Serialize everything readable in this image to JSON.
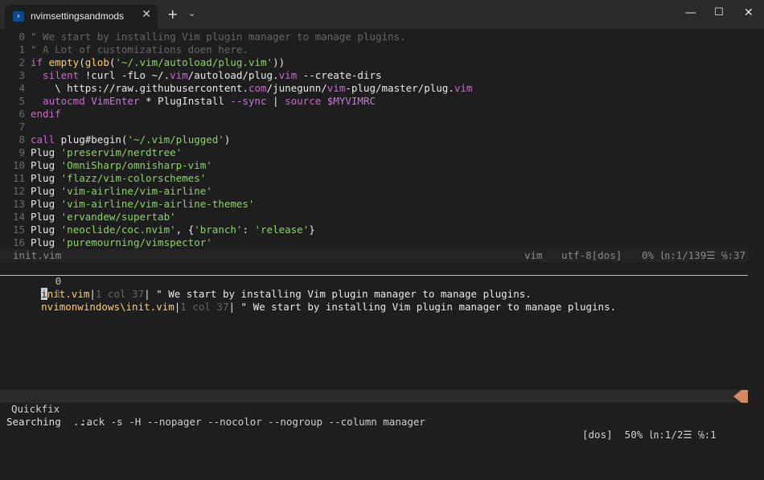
{
  "window": {
    "tab_title": "nvimsettingsandmods",
    "tab_icon": "powershell-icon",
    "new_tab": "+",
    "dropdown": "⌄",
    "close_tab": "✕",
    "minimize": "—",
    "maximize": "☐",
    "close": "✕"
  },
  "editor": {
    "lines": [
      {
        "n": "0",
        "segments": [
          {
            "t": "\" We start by installing Vim plugin manager to manage plugins.",
            "c": "c-comment"
          }
        ]
      },
      {
        "n": "1",
        "segments": [
          {
            "t": "\" A Lot of customizations doen here.",
            "c": "c-comment"
          }
        ]
      },
      {
        "n": "2",
        "segments": [
          {
            "t": "if ",
            "c": "c-kw"
          },
          {
            "t": "empty",
            "c": "c-fn"
          },
          {
            "t": "(",
            "c": "c-plain"
          },
          {
            "t": "glob",
            "c": "c-fn"
          },
          {
            "t": "(",
            "c": "c-plain"
          },
          {
            "t": "'~/.vim/autoload/plug.vim'",
            "c": "c-str"
          },
          {
            "t": "))",
            "c": "c-plain"
          }
        ]
      },
      {
        "n": "3",
        "segments": [
          {
            "t": "  silent ",
            "c": "c-kw"
          },
          {
            "t": "!curl -fLo ~/.",
            "c": "c-plain"
          },
          {
            "t": "vim",
            "c": "c-kw"
          },
          {
            "t": "/autoload/plug.",
            "c": "c-plain"
          },
          {
            "t": "vim",
            "c": "c-kw"
          },
          {
            "t": " --create-dirs",
            "c": "c-plain"
          }
        ]
      },
      {
        "n": "4",
        "segments": [
          {
            "t": "    \\ https://raw.githubusercontent.",
            "c": "c-plain"
          },
          {
            "t": "com",
            "c": "c-kw"
          },
          {
            "t": "/junegunn/",
            "c": "c-plain"
          },
          {
            "t": "vim",
            "c": "c-kw"
          },
          {
            "t": "-plug/master/plug.",
            "c": "c-plain"
          },
          {
            "t": "vim",
            "c": "c-kw"
          }
        ]
      },
      {
        "n": "5",
        "segments": [
          {
            "t": "  autocmd ",
            "c": "c-kw"
          },
          {
            "t": "VimEnter",
            "c": "c-var"
          },
          {
            "t": " * PlugInstall ",
            "c": "c-plain"
          },
          {
            "t": "--sync",
            "c": "c-var"
          },
          {
            "t": " | ",
            "c": "c-plain"
          },
          {
            "t": "source ",
            "c": "c-kw"
          },
          {
            "t": "$MYVIMRC",
            "c": "c-var"
          }
        ]
      },
      {
        "n": "6",
        "segments": [
          {
            "t": "endif",
            "c": "c-kw"
          }
        ]
      },
      {
        "n": "7",
        "segments": []
      },
      {
        "n": "8",
        "segments": [
          {
            "t": "call ",
            "c": "c-kw"
          },
          {
            "t": "plug#begin(",
            "c": "c-plain"
          },
          {
            "t": "'~/.vim/plugged'",
            "c": "c-str"
          },
          {
            "t": ")",
            "c": "c-plain"
          }
        ]
      },
      {
        "n": "9",
        "segments": [
          {
            "t": "Plug ",
            "c": "c-plain"
          },
          {
            "t": "'preservim/nerdtree'",
            "c": "c-str"
          }
        ]
      },
      {
        "n": "10",
        "segments": [
          {
            "t": "Plug ",
            "c": "c-plain"
          },
          {
            "t": "'OmniSharp/omnisharp-vim'",
            "c": "c-str"
          }
        ]
      },
      {
        "n": "11",
        "segments": [
          {
            "t": "Plug ",
            "c": "c-plain"
          },
          {
            "t": "'flazz/vim-colorschemes'",
            "c": "c-str"
          }
        ]
      },
      {
        "n": "12",
        "segments": [
          {
            "t": "Plug ",
            "c": "c-plain"
          },
          {
            "t": "'vim-airline/vim-airline'",
            "c": "c-str"
          }
        ]
      },
      {
        "n": "13",
        "segments": [
          {
            "t": "Plug ",
            "c": "c-plain"
          },
          {
            "t": "'vim-airline/vim-airline-themes'",
            "c": "c-str"
          }
        ]
      },
      {
        "n": "14",
        "segments": [
          {
            "t": "Plug ",
            "c": "c-plain"
          },
          {
            "t": "'ervandew/supertab'",
            "c": "c-str"
          }
        ]
      },
      {
        "n": "15",
        "segments": [
          {
            "t": "Plug ",
            "c": "c-plain"
          },
          {
            "t": "'neoclide/coc.nvim'",
            "c": "c-str"
          },
          {
            "t": ", {",
            "c": "c-plain"
          },
          {
            "t": "'branch'",
            "c": "c-str"
          },
          {
            "t": ": ",
            "c": "c-plain"
          },
          {
            "t": "'release'",
            "c": "c-str"
          },
          {
            "t": "}",
            "c": "c-plain"
          }
        ]
      },
      {
        "n": "16",
        "segments": [
          {
            "t": "Plug ",
            "c": "c-plain"
          },
          {
            "t": "'puremourning/vimspector'",
            "c": "c-str"
          }
        ]
      }
    ]
  },
  "statusline_top": {
    "file": "init.vim",
    "filetype": "vim",
    "encoding": "utf-8[dos]",
    "position": "0% ㏑:1/139☰ ℅:37"
  },
  "quickfix": {
    "rows": [
      {
        "n": "0",
        "file": "init.vim",
        "loc": "1 col 37",
        "text": " \" We start by installing Vim plugin manager to manage plugins."
      },
      {
        "n": "1",
        "file": "nvimonwindows\\init.vim",
        "loc": "1 col 37",
        "text": " \" We start by installing Vim plugin manager to manage plugins."
      }
    ]
  },
  "statusline_bottom": {
    "mode": "Quickfix",
    "command": ":ack -s -H --nopager --nocolor --nogroup --column manager",
    "right": "[dos]  50% ㏑:1/2☰ ℅:1"
  },
  "cmdline": {
    "text": "Searching  ..."
  },
  "colors": {
    "background": "#1e1e1e",
    "comment": "#666666",
    "keyword": "#d75fd7",
    "string": "#87d75f",
    "function": "#ffcc66",
    "accent": "#d7875f"
  }
}
